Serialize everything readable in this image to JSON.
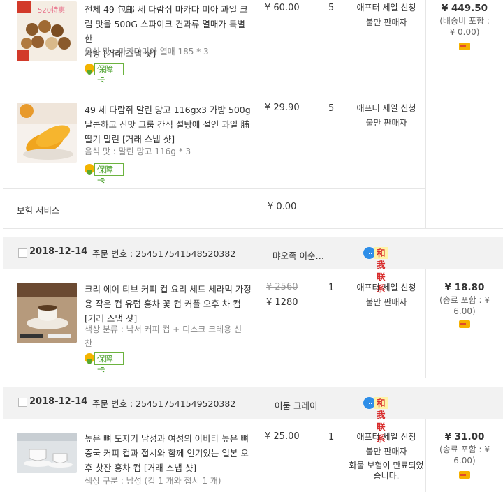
{
  "colors": {
    "border": "#e6e6e6",
    "header_bg": "#f2f2f2",
    "guard_green": "#3d9a1b",
    "contact_red": "#d82c2c",
    "contact_bg": "#fff3a6"
  },
  "order1": {
    "items": [
      {
        "title": "전체 49 包邮 세 다람쥐 마카다 미아 과일 크림 맛을 500G 스파이크 견과류 열매가 특별한 가방 [거래 스냅 샷]",
        "title_lines": [
          "전체 49 包邮 세 다람쥐 마카다 미아 과일 크",
          "림 맛을 500G 스파이크 견과류 열매가 특별한",
          "가방 [거래 스냅 샷]"
        ],
        "attr": "음식 맛 : 마카다미아 열매 185 * 3",
        "guarantee": "保障卡",
        "price": "¥ 60.00",
        "qty": "5",
        "status": [
          "애프터 세일 신청",
          "불만 판매자"
        ]
      },
      {
        "title": "49 세 다람쥐 말린 망고 116gx3 가방 500g 달콤하고 신맛 그룹 간식 설탕에 절인 과일 脯 딸기 말린 [거래 스냅 샷]",
        "title_lines": [
          "49 세 다람쥐 말린 망고 116gx3 가방 500g",
          "달콤하고 신맛 그룹 간식 설탕에 절인 과일 脯",
          "딸기 말린 [거래 스냅 샷]"
        ],
        "attr": "음식 맛 : 말린 망고 116g * 3",
        "guarantee": "保障卡",
        "price": "¥ 29.90",
        "qty": "5",
        "status": [
          "애프터 세일 신청",
          "불만 판매자"
        ]
      }
    ],
    "insurance_label": "보험 서비스",
    "insurance_price": "¥ 0.00",
    "total": "¥ 449.50",
    "shipping": "(배송비 포함 : ¥ 0.00)"
  },
  "order2": {
    "date": "2018-12-14",
    "order_no": "주문 번호 : 254517541548520382",
    "shop": "먀오족 이순…",
    "contact": "和我联系",
    "item": {
      "title_lines": [
        "크리 에이 티브 커피 컵 요리 세트 세라믹 가정",
        "용 작은 컵 유럽 홍차 꽃 컵 커플 오후 차 컵",
        "[거래 스냅 샷]"
      ],
      "attr_lines": [
        "색상 분류 : 낙서 커피 컵 + 디스크 크레용 신",
        "찬"
      ],
      "guarantee": "保障卡",
      "original_price": "¥ 2560",
      "price": "¥ 1280",
      "qty": "1",
      "status": [
        "애프터 세일 신청",
        "불만 판매자"
      ]
    },
    "total": "¥ 18.80",
    "shipping": "(송료 포함 : ¥ 6.00)"
  },
  "order3": {
    "date": "2018-12-14",
    "order_no": "주문 번호 : 254517541549520382",
    "shop": "어둠 그레이",
    "contact": "和我联系",
    "item": {
      "title_lines": [
        "높은 뼈 도자기 남성과 여성의 아바타 높은 뼈",
        "중국 커피 컵과 접시와 함께 인기있는 일본 오",
        "후 찻잔 홍차 컵 [거래 스냅 샷]"
      ],
      "attr": "색상 구분 : 남성 (컵 1 개와 접시 1 개)",
      "price": "¥ 25.00",
      "qty": "1",
      "status": [
        "애프터 세일 신청",
        "불만 판매자"
      ],
      "status_note_lines": [
        "화물 보험이 만료되었",
        "습니다."
      ]
    },
    "total": "¥ 31.00",
    "shipping": "(송료 포함 : ¥ 6.00)"
  }
}
